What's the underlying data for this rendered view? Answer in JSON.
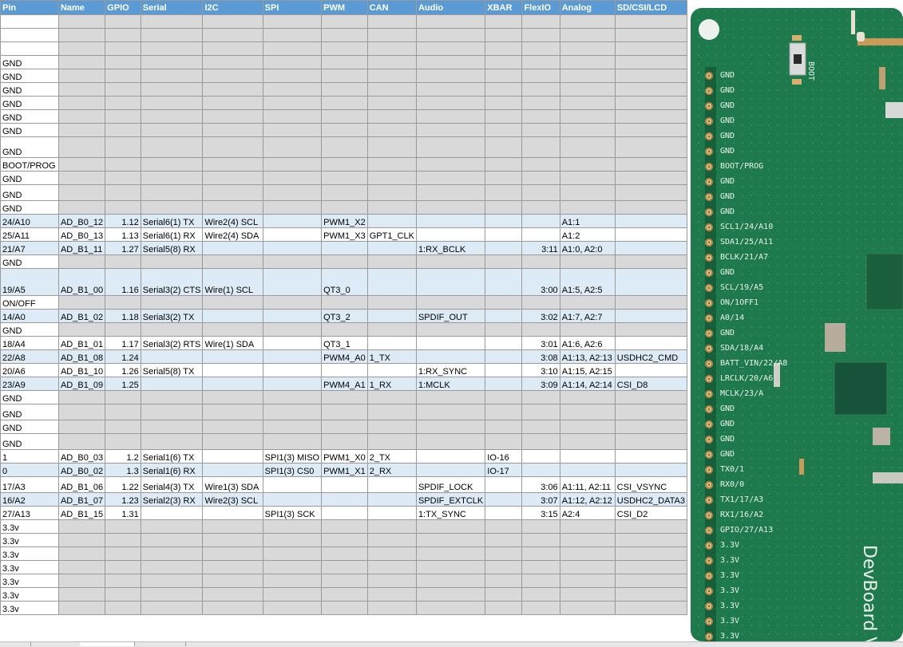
{
  "headers": [
    "Pin",
    "Name",
    "GPIO",
    "Serial",
    "I2C",
    "SPI",
    "PWM",
    "CAN",
    "Audio",
    "XBAR",
    "FlexIO",
    "Analog",
    "SD/CSI/LCD"
  ],
  "rows": [
    [
      "",
      "",
      "",
      "",
      "",
      "",
      "",
      "",
      "",
      "",
      "",
      "",
      ""
    ],
    [
      "",
      "",
      "",
      "",
      "",
      "",
      "",
      "",
      "",
      "",
      "",
      "",
      ""
    ],
    [
      "",
      "",
      "",
      "",
      "",
      "",
      "",
      "",
      "",
      "",
      "",
      "",
      ""
    ],
    [
      "GND",
      "",
      "",
      "",
      "",
      "",
      "",
      "",
      "",
      "",
      "",
      "",
      ""
    ],
    [
      "GND",
      "",
      "",
      "",
      "",
      "",
      "",
      "",
      "",
      "",
      "",
      "",
      ""
    ],
    [
      "GND",
      "",
      "",
      "",
      "",
      "",
      "",
      "",
      "",
      "",
      "",
      "",
      ""
    ],
    [
      "GND",
      "",
      "",
      "",
      "",
      "",
      "",
      "",
      "",
      "",
      "",
      "",
      ""
    ],
    [
      "GND",
      "",
      "",
      "",
      "",
      "",
      "",
      "",
      "",
      "",
      "",
      "",
      ""
    ],
    [
      "GND",
      "",
      "",
      "",
      "",
      "",
      "",
      "",
      "",
      "",
      "",
      "",
      ""
    ],
    [
      "GND",
      "",
      "",
      "",
      "",
      "",
      "",
      "",
      "",
      "",
      "",
      "",
      ""
    ],
    [
      "BOOT/PROG",
      "",
      "",
      "",
      "",
      "",
      "",
      "",
      "",
      "",
      "",
      "",
      ""
    ],
    [
      "GND",
      "",
      "",
      "",
      "",
      "",
      "",
      "",
      "",
      "",
      "",
      "",
      ""
    ],
    [
      "GND",
      "",
      "",
      "",
      "",
      "",
      "",
      "",
      "",
      "",
      "",
      "",
      ""
    ],
    [
      "GND",
      "",
      "",
      "",
      "",
      "",
      "",
      "",
      "",
      "",
      "",
      "",
      ""
    ],
    [
      "24/A10",
      "AD_B0_12",
      "1.12",
      "Serial6(1) TX",
      "Wire2(4) SCL",
      "",
      "PWM1_X2",
      "",
      "",
      "",
      "",
      "A1:1",
      ""
    ],
    [
      "25/A11",
      "AD_B0_13",
      "1.13",
      "Serial6(1) RX",
      "Wire2(4) SDA",
      "",
      "PWM1_X3",
      "GPT1_CLK",
      "",
      "",
      "",
      "A1:2",
      ""
    ],
    [
      "21/A7",
      "AD_B1_11",
      "1.27",
      "Serial5(8) RX",
      "",
      "",
      "",
      "",
      "1:RX_BCLK",
      "",
      "3:11",
      "A1:0, A2:0",
      ""
    ],
    [
      "GND",
      "",
      "",
      "",
      "",
      "",
      "",
      "",
      "",
      "",
      "",
      "",
      ""
    ],
    [
      "19/A5",
      "AD_B1_00",
      "1.16",
      "Serial3(2) CTS",
      "Wire(1) SCL",
      "",
      "QT3_0",
      "",
      "",
      "",
      "3:00",
      "A1:5, A2:5",
      ""
    ],
    [
      "ON/OFF",
      "",
      "",
      "",
      "",
      "",
      "",
      "",
      "",
      "",
      "",
      "",
      ""
    ],
    [
      "14/A0",
      "AD_B1_02",
      "1.18",
      "Serial3(2) TX",
      "",
      "",
      "QT3_2",
      "",
      "SPDIF_OUT",
      "",
      "3:02",
      "A1:7, A2:7",
      ""
    ],
    [
      "GND",
      "",
      "",
      "",
      "",
      "",
      "",
      "",
      "",
      "",
      "",
      "",
      ""
    ],
    [
      "18/A4",
      "AD_B1_01",
      "1.17",
      "Serial3(2) RTS",
      "Wire(1) SDA",
      "",
      "QT3_1",
      "",
      "",
      "",
      "3:01",
      "A1:6, A2:6",
      ""
    ],
    [
      "22/A8",
      "AD_B1_08",
      "1.24",
      "",
      "",
      "",
      "PWM4_A0",
      "1_TX",
      "",
      "",
      "3:08",
      "A1:13, A2:13",
      "USDHC2_CMD"
    ],
    [
      "20/A6",
      "AD_B1_10",
      "1.26",
      "Serial5(8) TX",
      "",
      "",
      "",
      "",
      "1:RX_SYNC",
      "",
      "3:10",
      "A1:15, A2:15",
      ""
    ],
    [
      "23/A9",
      "AD_B1_09",
      "1.25",
      "",
      "",
      "",
      "PWM4_A1",
      "1_RX",
      "1:MCLK",
      "",
      "3:09",
      "A1:14, A2:14",
      "CSI_D8"
    ],
    [
      "GND",
      "",
      "",
      "",
      "",
      "",
      "",
      "",
      "",
      "",
      "",
      "",
      ""
    ],
    [
      "GND",
      "",
      "",
      "",
      "",
      "",
      "",
      "",
      "",
      "",
      "",
      "",
      ""
    ],
    [
      "GND",
      "",
      "",
      "",
      "",
      "",
      "",
      "",
      "",
      "",
      "",
      "",
      ""
    ],
    [
      "GND",
      "",
      "",
      "",
      "",
      "",
      "",
      "",
      "",
      "",
      "",
      "",
      ""
    ],
    [
      "1",
      "AD_B0_03",
      "1.2",
      "Serial1(6) TX",
      "",
      "SPI1(3) MISO",
      "PWM1_X0",
      "2_TX",
      "",
      "IO-16",
      "",
      "",
      ""
    ],
    [
      "0",
      "AD_B0_02",
      "1.3",
      "Serial1(6) RX",
      "",
      "SPI1(3) CS0",
      "PWM1_X1",
      "2_RX",
      "",
      "IO-17",
      "",
      "",
      ""
    ],
    [
      "17/A3",
      "AD_B1_06",
      "1.22",
      "Serial4(3) TX",
      "Wire1(3) SDA",
      "",
      "",
      "",
      "SPDIF_LOCK",
      "",
      "3:06",
      "A1:11, A2:11",
      "CSI_VSYNC"
    ],
    [
      "16/A2",
      "AD_B1_07",
      "1.23",
      "Serial2(3) RX",
      "Wire2(3) SCL",
      "",
      "",
      "",
      "SPDIF_EXTCLK",
      "",
      "3:07",
      "A1:12, A2:12",
      "USDHC2_DATA3"
    ],
    [
      "27/A13",
      "AD_B1_15",
      "1.31",
      "",
      "",
      "SPI1(3) SCK",
      "",
      "",
      "1:TX_SYNC",
      "",
      "3:15",
      "A2:4",
      "CSI_D2"
    ],
    [
      "3.3v",
      "",
      "",
      "",
      "",
      "",
      "",
      "",
      "",
      "",
      "",
      "",
      ""
    ],
    [
      "3.3v",
      "",
      "",
      "",
      "",
      "",
      "",
      "",
      "",
      "",
      "",
      "",
      ""
    ],
    [
      "3.3v",
      "",
      "",
      "",
      "",
      "",
      "",
      "",
      "",
      "",
      "",
      "",
      ""
    ],
    [
      "3.3v",
      "",
      "",
      "",
      "",
      "",
      "",
      "",
      "",
      "",
      "",
      "",
      ""
    ],
    [
      "3.3v",
      "",
      "",
      "",
      "",
      "",
      "",
      "",
      "",
      "",
      "",
      "",
      ""
    ],
    [
      "3.3v",
      "",
      "",
      "",
      "",
      "",
      "",
      "",
      "",
      "",
      "",
      "",
      ""
    ],
    [
      "3.3v",
      "",
      "",
      "",
      "",
      "",
      "",
      "",
      "",
      "",
      "",
      "",
      ""
    ]
  ],
  "pcb": {
    "boot_label": "BOOT",
    "board_text": "DevBoard V",
    "pin_labels": [
      "GND",
      "GND",
      "GND",
      "GND",
      "GND",
      "GND",
      "BOOT/PROG",
      "GND",
      "GND",
      "GND",
      "SCL1/24/A10",
      "SDA1/25/A11",
      "BCLK/21/A7",
      "GND",
      "SCL/19/A5",
      "ON/1OFF1",
      "A0/14",
      "GND",
      "SDA/18/A4",
      "BATT_VIN/22/A8",
      "LRCLK/20/A6",
      "MCLK/23/A",
      "GND",
      "GND",
      "GND",
      "GND",
      "TX0/1",
      "RX0/0",
      "TX1/17/A3",
      "RX1/16/A2",
      "GPIO/27/A13",
      "3.3V",
      "3.3V",
      "3.3V",
      "3.3V",
      "3.3V",
      "3.3V",
      "3.3V"
    ]
  },
  "colors": {
    "header": "#5b9bd5",
    "blue_row": "#ddebf7",
    "gray_row": "#d9d9d9",
    "board_green": "#1e7a4d",
    "pad_gold": "#e1b978"
  }
}
